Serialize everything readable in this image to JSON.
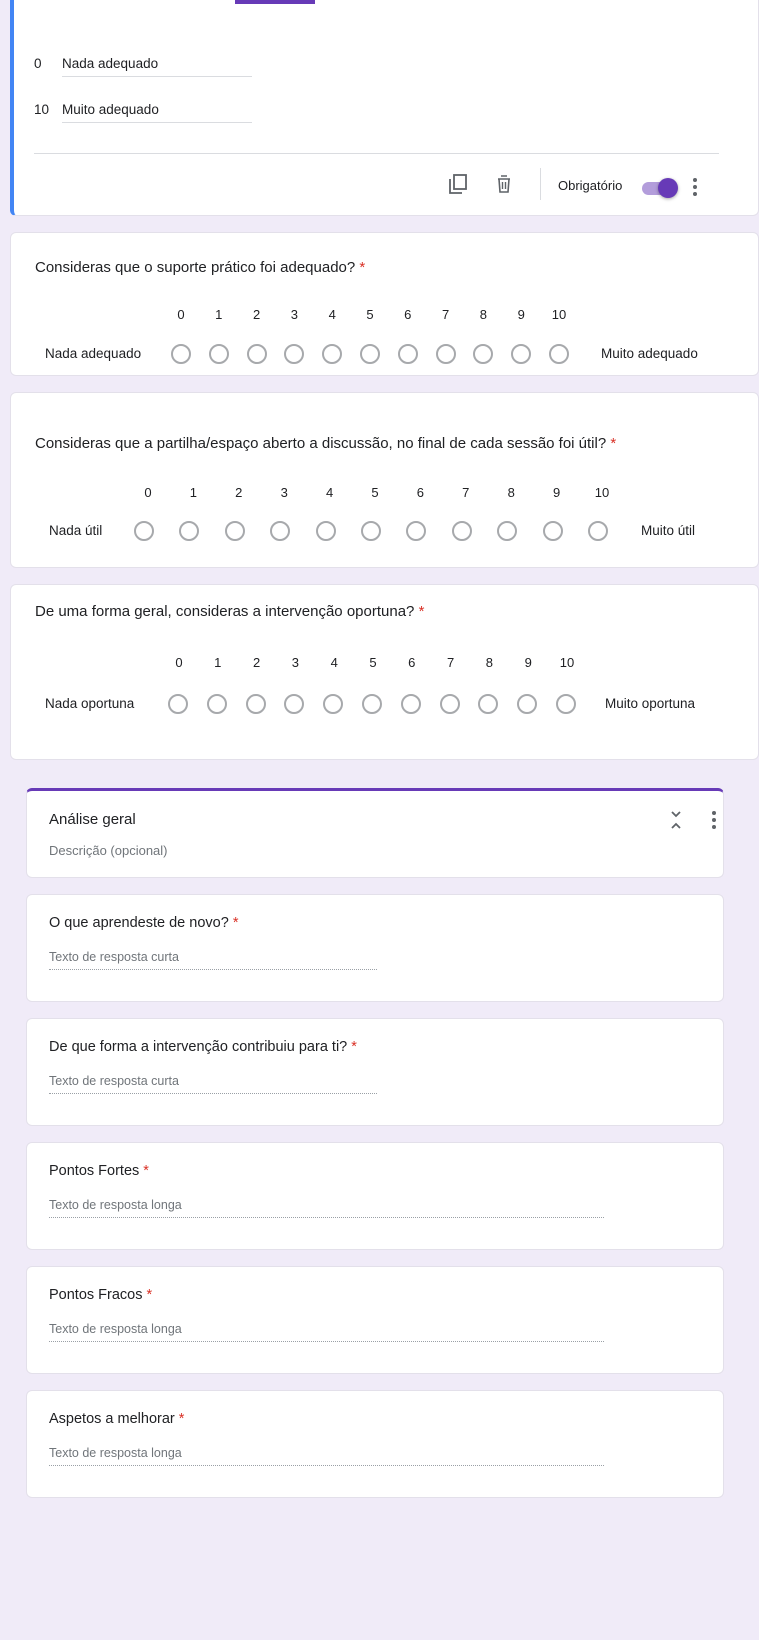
{
  "edit_card": {
    "scale_labels": [
      {
        "num": "0",
        "label": "Nada adequado"
      },
      {
        "num": "10",
        "label": "Muito adequado"
      }
    ],
    "toolbar": {
      "required_label": "Obrigatório",
      "required_on": true,
      "icons": [
        "duplicate-icon",
        "trash-icon",
        "more-vert-icon"
      ]
    }
  },
  "scale_questions": [
    {
      "title": "Consideras que o suporte prático foi adequado?",
      "scale": [
        "0",
        "1",
        "2",
        "3",
        "4",
        "5",
        "6",
        "7",
        "8",
        "9",
        "10"
      ],
      "min_label": "Nada adequado",
      "max_label": "Muito adequado"
    },
    {
      "title": "Consideras que a partilha/espaço aberto a discussão, no final de cada sessão foi útil?",
      "scale": [
        "0",
        "1",
        "2",
        "3",
        "4",
        "5",
        "6",
        "7",
        "8",
        "9",
        "10"
      ],
      "min_label": "Nada útil",
      "max_label": "Muito útil"
    },
    {
      "title": "De uma forma geral, consideras a intervenção oportuna?",
      "scale": [
        "0",
        "1",
        "2",
        "3",
        "4",
        "5",
        "6",
        "7",
        "8",
        "9",
        "10"
      ],
      "min_label": "Nada oportuna",
      "max_label": "Muito oportuna"
    }
  ],
  "section": {
    "title": "Análise geral",
    "description": "Descrição (opcional)"
  },
  "text_questions": [
    {
      "title": "O que aprendeste de novo?",
      "placeholder": "Texto de resposta curta"
    },
    {
      "title": "De que forma a intervenção contribuiu para ti?",
      "placeholder": "Texto de resposta curta"
    },
    {
      "title": "Pontos Fortes",
      "placeholder": "Texto de resposta longa"
    },
    {
      "title": "Pontos Fracos",
      "placeholder": "Texto de resposta longa"
    },
    {
      "title": "Aspetos a melhorar",
      "placeholder": "Texto de resposta longa"
    }
  ],
  "required_marker": "*",
  "colors": {
    "accent": "#673ab7",
    "focus_bar": "#4285f4",
    "required": "#d93025",
    "background": "#f0ebf8"
  }
}
